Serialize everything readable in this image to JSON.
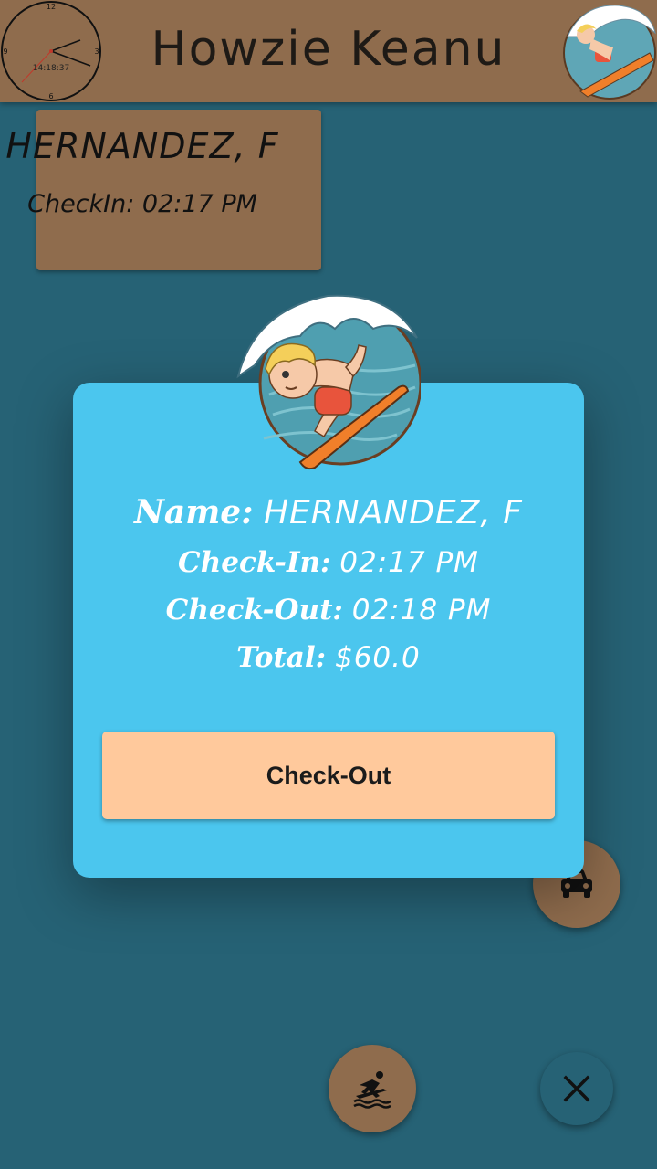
{
  "header": {
    "title": "Howzie Keanu",
    "clock": {
      "time": "14:18:37",
      "n12": "12",
      "n3": "3",
      "n6": "6",
      "n9": "9"
    }
  },
  "summary_card": {
    "name": "HERNANDEZ, F",
    "checkin": "CheckIn: 02:17 PM"
  },
  "modal": {
    "name_label": "Name:",
    "name_value": "HERNANDEZ, F",
    "checkin_label": "Check-In:",
    "checkin_value": "02:17 PM",
    "checkout_label": "Check-Out:",
    "checkout_value": "02:18 PM",
    "total_label": "Total:",
    "total_value": "$60.0",
    "button_label": "Check-Out"
  },
  "fabs": {
    "car": "car-icon",
    "surf": "surfer-icon",
    "close": "close-icon"
  },
  "colors": {
    "background": "#266275",
    "brown": "#8f6c4d",
    "modal": "#4bc6ee",
    "button": "#ffc99c"
  }
}
